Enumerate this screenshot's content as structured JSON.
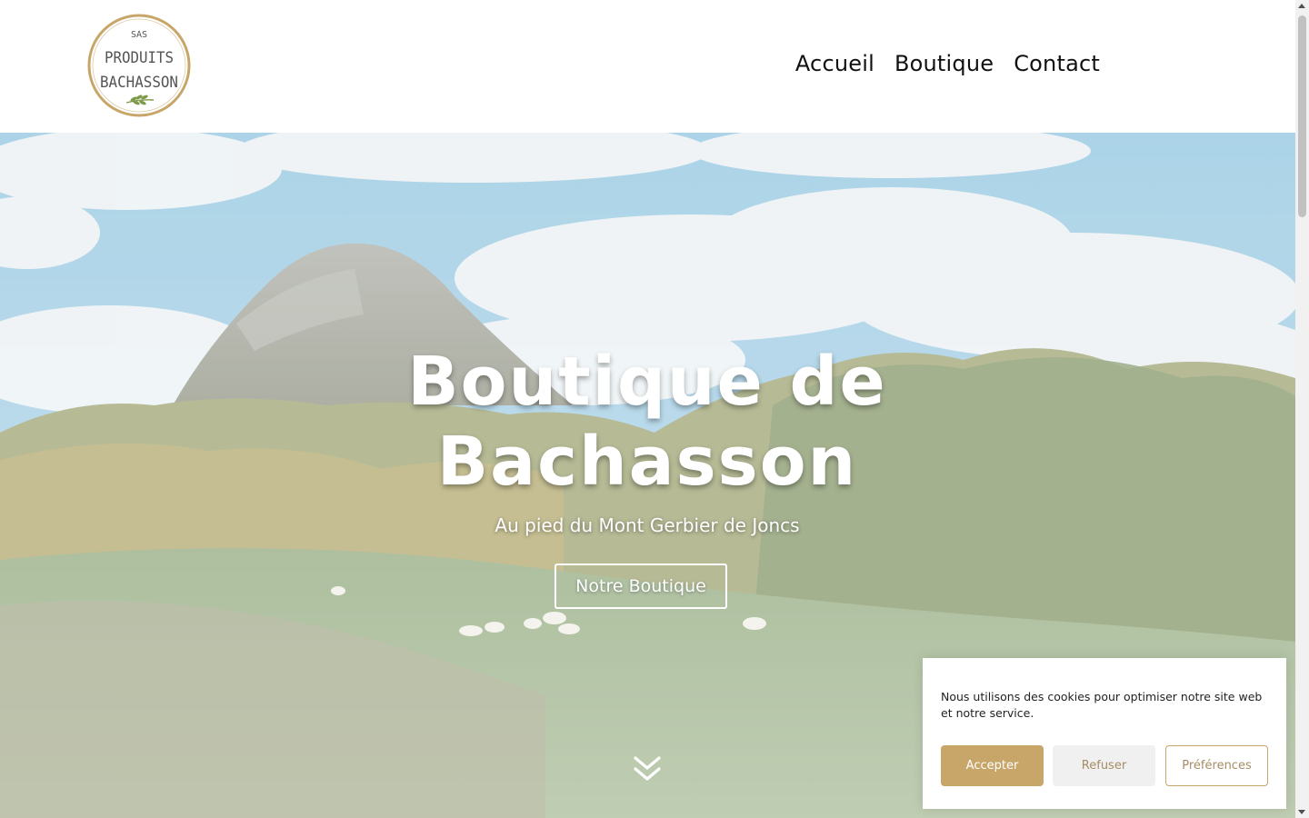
{
  "logo": {
    "line1": "SAS",
    "line2": "PRODUITS",
    "line3": "BACHASSON",
    "ring_color": "#c8a669",
    "leaf_color": "#7d9a4a"
  },
  "nav": {
    "items": [
      {
        "label": "Accueil"
      },
      {
        "label": "Boutique"
      },
      {
        "label": "Contact"
      }
    ]
  },
  "hero": {
    "title": "Boutique de Bachasson",
    "subtitle": "Au pied du Mont Gerbier de Joncs",
    "cta_label": "Notre Boutique",
    "scroll_icon": "double-chevron-down-icon"
  },
  "cookie": {
    "message": "Nous utilisons des cookies pour optimiser notre site web et notre service.",
    "accept_label": "Accepter",
    "refuse_label": "Refuser",
    "preferences_label": "Préférences",
    "accent_color": "#c8a669"
  }
}
